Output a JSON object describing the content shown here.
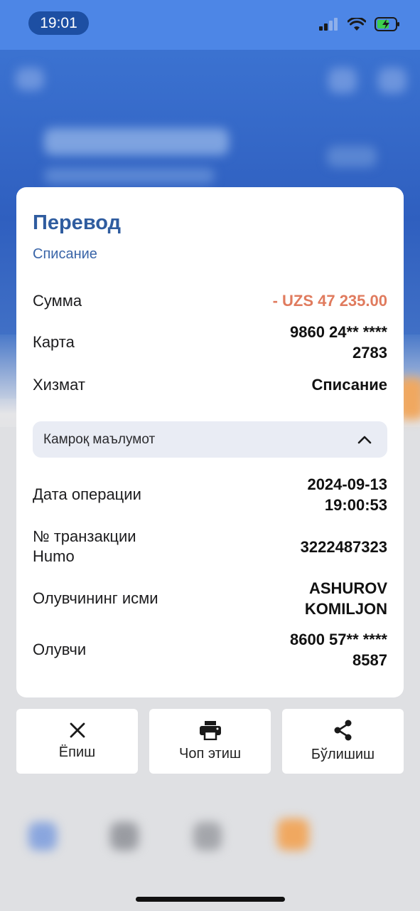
{
  "status_bar": {
    "time": "19:01"
  },
  "card": {
    "title": "Перевод",
    "subtitle": "Списание",
    "amount_label": "Сумма",
    "amount_value": "- UZS 47 235.00",
    "card_label": "Карта",
    "card_value_line1": "9860 24** ****",
    "card_value_line2": "2783",
    "service_label": "Хизмат",
    "service_value": "Списание",
    "more_info_label": "Камроқ маълумот",
    "date_label": "Дата операции",
    "date_value_line1": "2024-09-13",
    "date_value_line2": "19:00:53",
    "txn_label_line1": "№ транзакции",
    "txn_label_line2": "Humo",
    "txn_value": "3222487323",
    "recipient_name_label": "Олувчининг исми",
    "recipient_name_line1": "ASHUROV",
    "recipient_name_line2": "KOMILJON",
    "recipient_label": "Олувчи",
    "recipient_value_line1": "8600 57** ****",
    "recipient_value_line2": "8587"
  },
  "actions": {
    "close_label": "Ёпиш",
    "print_label": "Чоп этиш",
    "share_label": "Бўлишиш"
  },
  "colors": {
    "title": "#2f5c9f",
    "amount": "#e07b5e",
    "accent_bg": "#e9ecf4"
  }
}
